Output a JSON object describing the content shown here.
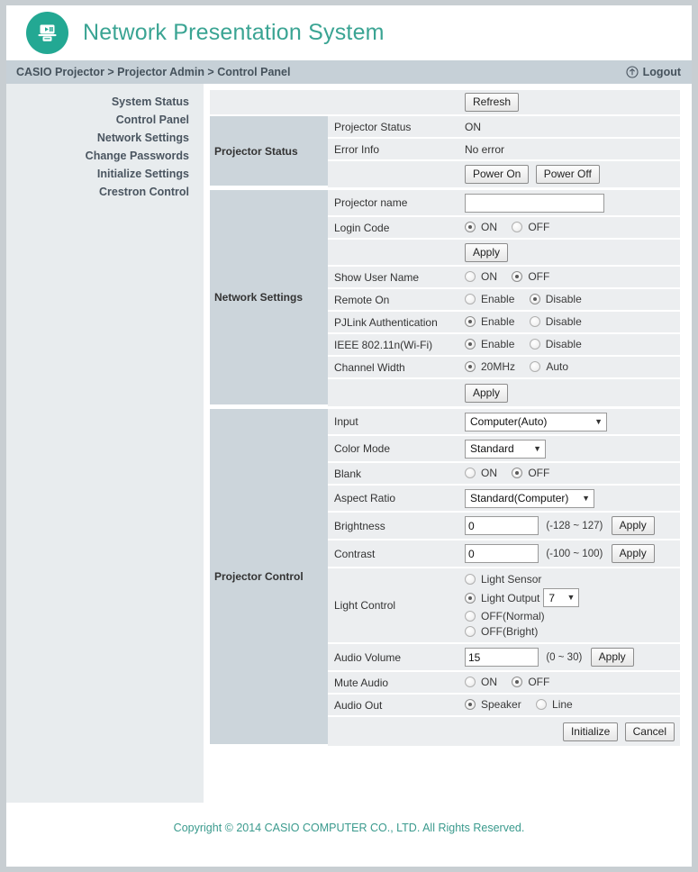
{
  "header": {
    "logo_icon": "projector-play-icon",
    "app_title": "Network Presentation System"
  },
  "breadcrumb": {
    "text": "CASIO Projector > Projector Admin > Control Panel",
    "logout_label": "Logout",
    "logout_icon": "circle-up-arrow-icon"
  },
  "sidebar": {
    "items": [
      {
        "label": "System Status"
      },
      {
        "label": "Control Panel"
      },
      {
        "label": "Network Settings"
      },
      {
        "label": "Change Passwords"
      },
      {
        "label": "Initialize Settings"
      },
      {
        "label": "Crestron Control"
      }
    ]
  },
  "projector_status": {
    "section_label": "Projector Status",
    "refresh_button": "Refresh",
    "rows": [
      {
        "label": "Projector Status",
        "value": "ON"
      },
      {
        "label": "Error Info",
        "value": "No error"
      }
    ],
    "power_on_button": "Power On",
    "power_off_button": "Power Off"
  },
  "network_settings": {
    "section_label": "Network Settings",
    "projector_name": {
      "label": "Projector name",
      "value": "",
      "placeholder": ""
    },
    "login_code": {
      "label": "Login Code",
      "options": [
        "ON",
        "OFF"
      ],
      "selected": "ON"
    },
    "apply_button_1": "Apply",
    "show_user_name": {
      "label": "Show User Name",
      "options": [
        "ON",
        "OFF"
      ],
      "selected": "OFF"
    },
    "remote_on": {
      "label": "Remote On",
      "options": [
        "Enable",
        "Disable"
      ],
      "selected": "Disable"
    },
    "pjlink_authentication": {
      "label": "PJLink Authentication",
      "options": [
        "Enable",
        "Disable"
      ],
      "selected": "Enable"
    },
    "ieee_wifi": {
      "label": "IEEE 802.11n(Wi-Fi)",
      "options": [
        "Enable",
        "Disable"
      ],
      "selected": "Enable"
    },
    "channel_width": {
      "label": "Channel Width",
      "options": [
        "20MHz",
        "Auto"
      ],
      "selected": "20MHz"
    },
    "apply_button_2": "Apply"
  },
  "projector_control": {
    "section_label": "Projector Control",
    "input": {
      "label": "Input",
      "selected": "Computer(Auto)"
    },
    "color_mode": {
      "label": "Color Mode",
      "selected": "Standard"
    },
    "blank": {
      "label": "Blank",
      "options": [
        "ON",
        "OFF"
      ],
      "selected": "OFF"
    },
    "aspect_ratio": {
      "label": "Aspect Ratio",
      "selected": "Standard(Computer)"
    },
    "brightness": {
      "label": "Brightness",
      "value": "0",
      "range": "(-128 ~ 127)",
      "apply_button": "Apply"
    },
    "contrast": {
      "label": "Contrast",
      "value": "0",
      "range": "(-100 ~ 100)",
      "apply_button": "Apply"
    },
    "light_control": {
      "label": "Light Control",
      "options": [
        "Light Sensor",
        "Light Output",
        "OFF(Normal)",
        "OFF(Bright)"
      ],
      "selected": "Light Output",
      "light_output_value": "7"
    },
    "audio_volume": {
      "label": "Audio Volume",
      "value": "15",
      "range": "(0 ~ 30)",
      "apply_button": "Apply"
    },
    "mute_audio": {
      "label": "Mute Audio",
      "options": [
        "ON",
        "OFF"
      ],
      "selected": "OFF"
    },
    "audio_out": {
      "label": "Audio Out",
      "options": [
        "Speaker",
        "Line"
      ],
      "selected": "Speaker"
    },
    "initialize_button": "Initialize",
    "cancel_button": "Cancel"
  },
  "footer": {
    "copyright": "Copyright © 2014 CASIO COMPUTER CO., LTD. All Rights Reserved."
  },
  "colors": {
    "brand_teal": "#23a893",
    "title_teal": "#3aa493",
    "breadcrumb_bar": "#c6d0d7",
    "section_header": "#ccd5db",
    "row_bg": "#eceef0",
    "sidebar_bg": "#e8ecee",
    "page_bg": "#c8ced2"
  }
}
